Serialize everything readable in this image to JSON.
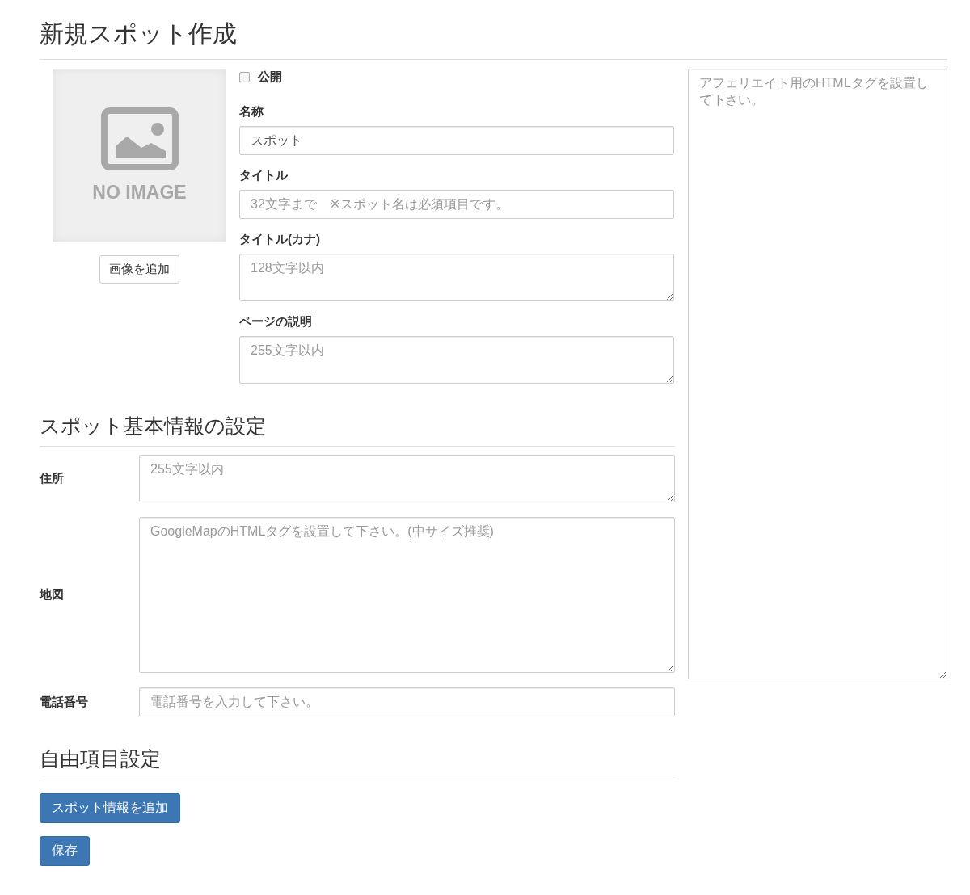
{
  "page_title": "新規スポット作成",
  "image": {
    "label": "NO IMAGE"
  },
  "add_image_button": "画像を追加",
  "publish": {
    "label": "公開",
    "checked": false
  },
  "fields": [
    {
      "label": "名称",
      "kind": "input",
      "value": "スポット"
    },
    {
      "label": "タイトル",
      "kind": "input",
      "placeholder": "32文字まで　※スポット名は必須項目です。"
    },
    {
      "label": "タイトル(カナ)",
      "kind": "textarea",
      "placeholder": "128文字以内"
    },
    {
      "label": "ページの説明",
      "kind": "textarea",
      "placeholder": "255文字以内"
    }
  ],
  "affiliate": {
    "placeholder": "アフェリエイト用のHTMLタグを設置して下さい。"
  },
  "basic_section": {
    "title": "スポット基本情報の設定",
    "fields": [
      {
        "label": "住所",
        "kind": "textarea",
        "placeholder": "255文字以内"
      },
      {
        "label": "地図",
        "kind": "large_textarea",
        "placeholder": "GoogleMapのHTMLタグを設置して下さい。(中サイズ推奨)"
      },
      {
        "label": "電話番号",
        "kind": "input",
        "placeholder": "電話番号を入力して下さい。"
      }
    ]
  },
  "free_section": {
    "title": "自由項目設定",
    "add_button": "スポット情報を追加"
  },
  "save_button": "保存"
}
